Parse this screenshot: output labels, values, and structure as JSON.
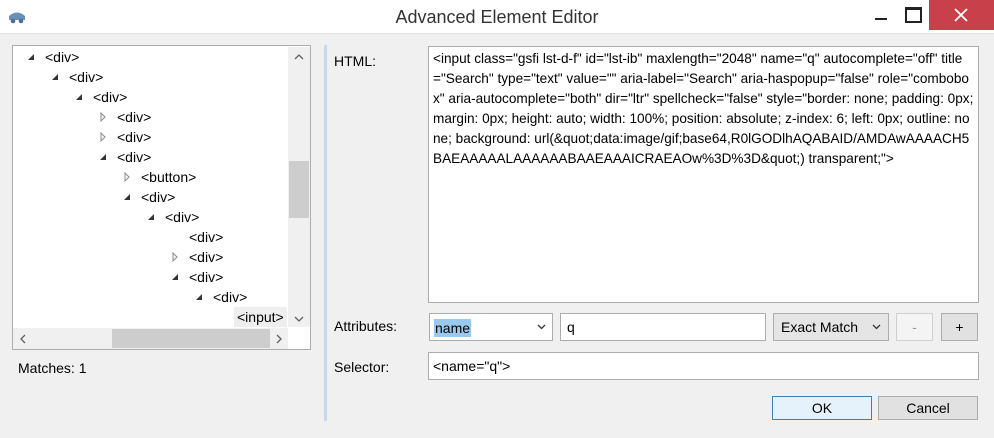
{
  "window": {
    "title": "Advanced Element Editor",
    "icon": "app-icon"
  },
  "tree": {
    "nodes": [
      {
        "label": "<div>",
        "expanded": true,
        "has_children": true
      },
      {
        "label": "<div>",
        "expanded": true,
        "has_children": true
      },
      {
        "label": "<div>",
        "expanded": true,
        "has_children": true
      },
      {
        "label": "<div>",
        "expanded": false,
        "has_children": true
      },
      {
        "label": "<div>",
        "expanded": false,
        "has_children": true
      },
      {
        "label": "<div>",
        "expanded": true,
        "has_children": true
      },
      {
        "label": "<button>",
        "expanded": false,
        "has_children": true
      },
      {
        "label": "<div>",
        "expanded": true,
        "has_children": true
      },
      {
        "label": "<div>",
        "expanded": true,
        "has_children": true
      },
      {
        "label": "<div>",
        "expanded": false,
        "has_children": false
      },
      {
        "label": "<div>",
        "expanded": false,
        "has_children": true
      },
      {
        "label": "<div>",
        "expanded": true,
        "has_children": true
      },
      {
        "label": "<div>",
        "expanded": true,
        "has_children": true
      },
      {
        "label": "<input>",
        "expanded": false,
        "has_children": false,
        "selected": true
      }
    ]
  },
  "matches": {
    "label": "Matches: 1"
  },
  "html_field": {
    "label": "HTML:",
    "value": "<input class=\"gsfi lst-d-f\" id=\"lst-ib\" maxlength=\"2048\" name=\"q\" autocomplete=\"off\" title=\"Search\" type=\"text\" value=\"\" aria-label=\"Search\" aria-haspopup=\"false\" role=\"combobox\" aria-autocomplete=\"both\" dir=\"ltr\" spellcheck=\"false\" style=\"border: none; padding: 0px; margin: 0px; height: auto; width: 100%; position: absolute; z-index: 6; left: 0px; outline: none; background: url(&quot;data:image/gif;base64,R0lGODlhAQABAID/AMDAwAAAACH5BAEAAAAALAAAAAABAAEAAAICRAEAOw%3D%3D&quot;) transparent;\">"
  },
  "attributes": {
    "label": "Attributes:",
    "name_value": "name",
    "value": "q",
    "match_mode": "Exact Match",
    "remove_label": "-",
    "add_label": "+"
  },
  "selector": {
    "label": "Selector:",
    "value": "<name=\"q\">"
  },
  "buttons": {
    "ok": "OK",
    "cancel": "Cancel"
  },
  "colors": {
    "close_button": "#c8404a",
    "selection_highlight": "#99c9ef",
    "ok_border": "#3c7fb1"
  }
}
